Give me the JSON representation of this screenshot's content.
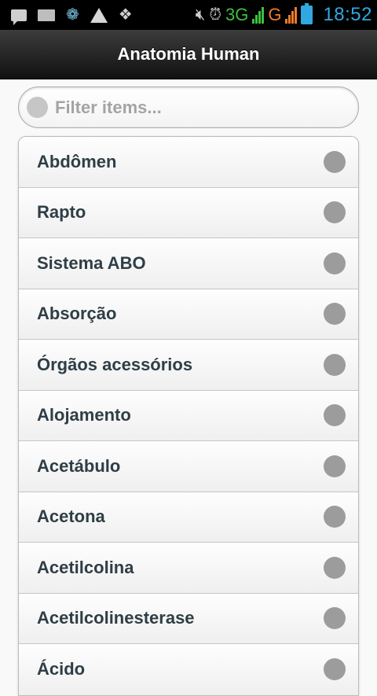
{
  "status_bar": {
    "network_3g": "3G",
    "network_g": "G",
    "time": "18:52"
  },
  "header": {
    "title": "Anatomia Human"
  },
  "filter": {
    "placeholder": "Filter items...",
    "value": ""
  },
  "list": {
    "items": [
      {
        "label": "Abdômen"
      },
      {
        "label": "Rapto"
      },
      {
        "label": "Sistema ABO"
      },
      {
        "label": "Absorção"
      },
      {
        "label": "Órgãos acessórios"
      },
      {
        "label": "Alojamento"
      },
      {
        "label": "Acetábulo"
      },
      {
        "label": "Acetona"
      },
      {
        "label": "Acetilcolina"
      },
      {
        "label": "Acetilcolinesterase"
      },
      {
        "label": "Ácido"
      }
    ]
  },
  "colors": {
    "header_bg": "#111111",
    "network_3g": "#3fbf3f",
    "network_g": "#f07a2a",
    "clock": "#31a8e0",
    "item_text": "#2f3e46"
  }
}
